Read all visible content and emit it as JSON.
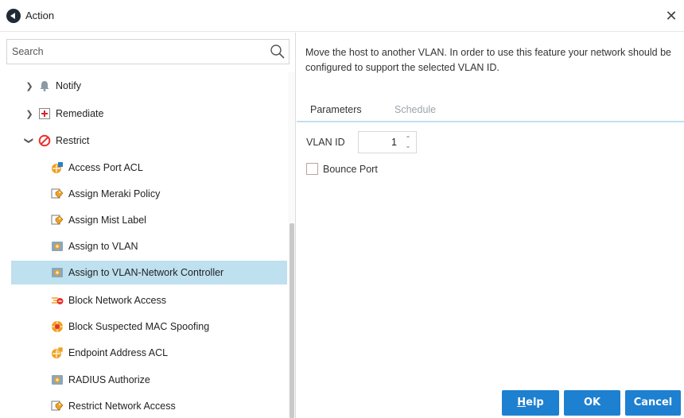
{
  "window": {
    "title": "Action"
  },
  "search": {
    "placeholder": "Search"
  },
  "tree": {
    "items": [
      {
        "label": "Notify",
        "level": 0,
        "expanded": false,
        "icon": "bell-icon"
      },
      {
        "label": "Remediate",
        "level": 0,
        "expanded": false,
        "icon": "plus-box-icon"
      },
      {
        "label": "Restrict",
        "level": 0,
        "expanded": true,
        "icon": "prohibited-icon"
      },
      {
        "label": "Access Port ACL",
        "level": 1,
        "icon": "acl-shield-icon"
      },
      {
        "label": "Assign Meraki Policy",
        "level": 1,
        "icon": "tag-policy-icon"
      },
      {
        "label": "Assign Mist Label",
        "level": 1,
        "icon": "tag-policy-icon"
      },
      {
        "label": "Assign to VLAN",
        "level": 1,
        "icon": "vlan-box-icon"
      },
      {
        "label": "Assign to VLAN-Network Controller",
        "level": 1,
        "icon": "vlan-box-icon",
        "selected": true
      },
      {
        "label": "Block Network Access",
        "level": 1,
        "icon": "block-network-icon"
      },
      {
        "label": "Block Suspected MAC Spoofing",
        "level": 1,
        "icon": "mac-spoof-icon"
      },
      {
        "label": "Endpoint Address ACL",
        "level": 1,
        "icon": "acl-shield-icon"
      },
      {
        "label": "RADIUS Authorize",
        "level": 1,
        "icon": "vlan-box-icon"
      },
      {
        "label": "Restrict Network Access",
        "level": 1,
        "icon": "tag-policy-icon"
      }
    ]
  },
  "details": {
    "description": "Move the host to another VLAN. In order to use this feature your network should be configured to support the selected VLAN ID.",
    "tabs": [
      {
        "label": "Parameters",
        "active": true
      },
      {
        "label": "Schedule",
        "active": false
      }
    ],
    "vlan_id": {
      "label": "VLAN ID",
      "value": "1"
    },
    "bounce_port": {
      "label": "Bounce Port",
      "checked": false
    }
  },
  "buttons": {
    "help": {
      "mnemonic": "H",
      "rest": "elp"
    },
    "ok": "OK",
    "cancel": "Cancel"
  },
  "colors": {
    "accent": "#1e80d0",
    "selection": "#bee0ef",
    "tab_underline": "#bfe0ef"
  }
}
